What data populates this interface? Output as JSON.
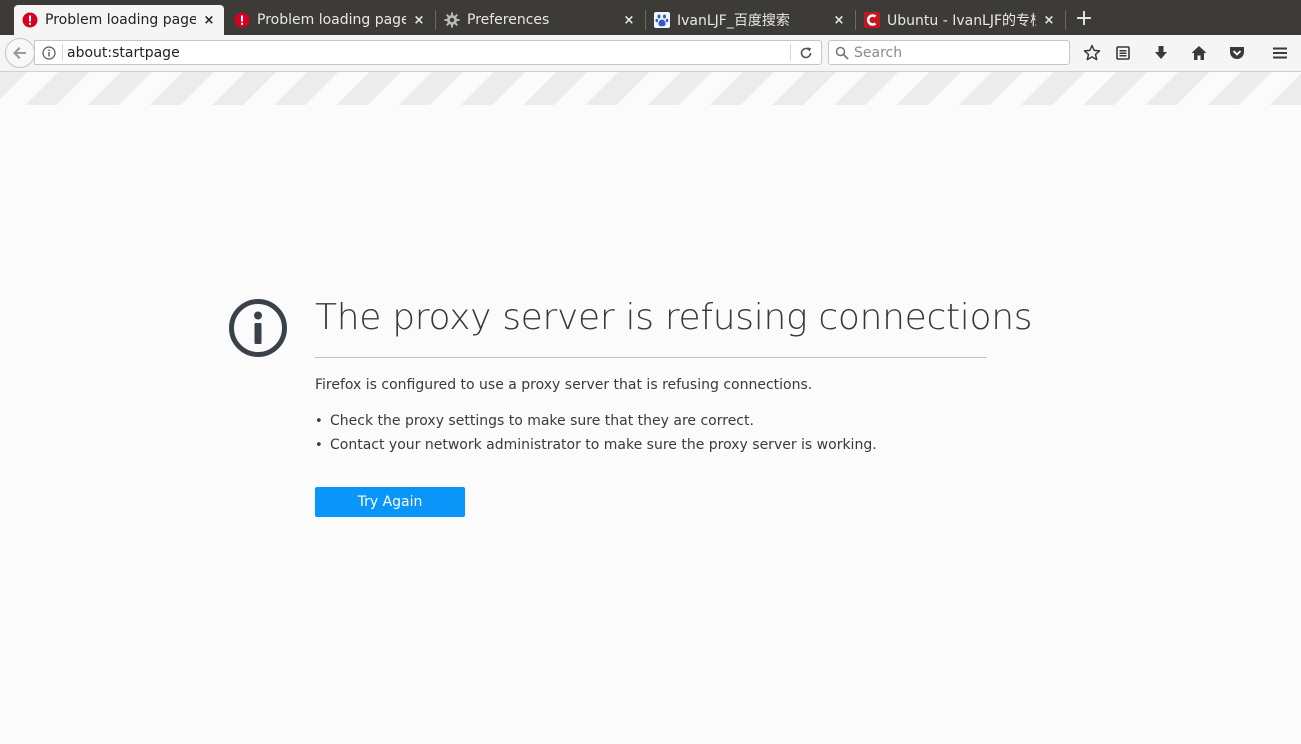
{
  "tabs": [
    {
      "title": "Problem loading page",
      "icon": "error-icon",
      "active": true
    },
    {
      "title": "Problem loading page",
      "icon": "error-icon",
      "active": false
    },
    {
      "title": "Preferences",
      "icon": "gear-icon",
      "active": false
    },
    {
      "title": "IvanLJF_百度搜索",
      "icon": "baidu-icon",
      "active": false
    },
    {
      "title": "Ubuntu - IvanLJF的专栏",
      "icon": "csdn-icon",
      "active": false
    }
  ],
  "tab_close_glyph": "×",
  "new_tab_glyph": "+",
  "navbar": {
    "url": "about:startpage",
    "search_placeholder": "Search"
  },
  "error": {
    "title": "The proxy server is refusing connections",
    "description": "Firefox is configured to use a proxy server that is refusing connections.",
    "bullets": [
      "Check the proxy settings to make sure that they are correct.",
      "Contact your network administrator to make sure the proxy server is working."
    ],
    "bullet_glyph": "•",
    "button_label": "Try Again"
  },
  "colors": {
    "tabbar_bg": "#3c3b37",
    "button_bg": "#0996f8",
    "error_icon": "#3b4148",
    "error_badge": "#d70022",
    "csdn_red": "#c9151e"
  }
}
